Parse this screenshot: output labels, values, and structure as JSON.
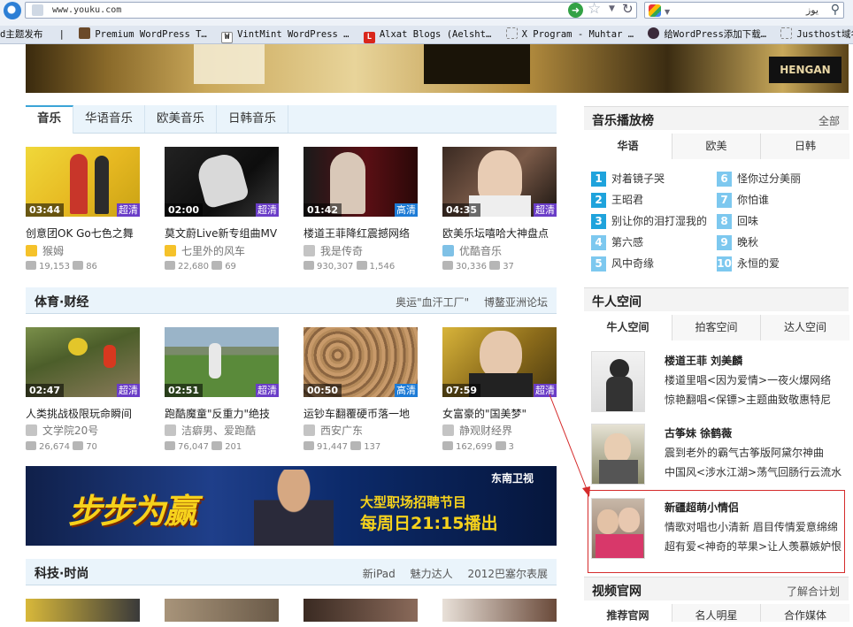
{
  "browser": {
    "url": "www.youku.com",
    "search_text": "يوز",
    "bookmarks": [
      "d主题发布",
      "Premium WordPress T…",
      "VintMint WordPress …",
      "Alxat Blogs (Aelsht…",
      "X Program - Muhtar …",
      "给WordPress添加下载…",
      "Justhost域名注册"
    ]
  },
  "music": {
    "tabs": [
      "音乐",
      "华语音乐",
      "欧美音乐",
      "日韩音乐"
    ],
    "videos": [
      {
        "duration": "03:44",
        "quality": "超清",
        "title": "创意团OK Go七色之舞",
        "user": "猴姆",
        "views": "19,153",
        "comments": "86"
      },
      {
        "duration": "02:00",
        "quality": "超清",
        "title": "莫文蔚Live新专组曲MV",
        "user": "七里外的风车",
        "views": "22,680",
        "comments": "69"
      },
      {
        "duration": "01:42",
        "quality": "高清",
        "title": "楼道王菲降红震撼网络",
        "user": "我是传奇",
        "views": "930,307",
        "comments": "1,546"
      },
      {
        "duration": "04:35",
        "quality": "超清",
        "title": "欧美乐坛嘻哈大神盘点",
        "user": "优酷音乐",
        "views": "30,336",
        "comments": "37"
      }
    ]
  },
  "sports": {
    "title": "体育·财经",
    "links": [
      "奥运\"血汗工厂\"",
      "博鳌亚洲论坛"
    ],
    "videos": [
      {
        "duration": "02:47",
        "quality": "超清",
        "title": "人类挑战极限玩命瞬间",
        "user": "文学院20号",
        "views": "26,674",
        "comments": "70"
      },
      {
        "duration": "02:51",
        "quality": "超清",
        "title": "跑酷魔童\"反重力\"绝技",
        "user": "洁癖男、爱跑酷",
        "views": "76,047",
        "comments": "201"
      },
      {
        "duration": "00:50",
        "quality": "高清",
        "title": "运钞车翻覆硬币落一地",
        "user": "西安广东",
        "views": "91,447",
        "comments": "137"
      },
      {
        "duration": "07:59",
        "quality": "超清",
        "title": "女富豪的\"国美梦\"",
        "user": "静观财经界",
        "views": "162,699",
        "comments": "3"
      }
    ]
  },
  "banner": {
    "channel": "东南卫视",
    "program": "大型职场招聘节目",
    "schedule": "每周日21:15播出"
  },
  "tech": {
    "title": "科技·时尚",
    "links": [
      "新iPad",
      "魅力达人",
      "2012巴塞尔表展"
    ]
  },
  "chart": {
    "title": "音乐播放榜",
    "more": "全部",
    "tabs": [
      "华语",
      "欧美",
      "日韩"
    ],
    "items": [
      "对着镜子哭",
      "王昭君",
      "别让你的泪打湿我的",
      "第六感",
      "风中奇缘",
      "怪你过分美丽",
      "你怕谁",
      "回味",
      "晚秋",
      "永恒的爱"
    ]
  },
  "people": {
    "title": "牛人空间",
    "tabs": [
      "牛人空间",
      "拍客空间",
      "达人空间"
    ],
    "stars": [
      {
        "name": "楼道王菲 刘美麟",
        "line1": "楼道里唱<因为爱情>一夜火爆网络",
        "line2": "惊艳翻唱<保镖>主题曲致敬惠特尼"
      },
      {
        "name": "古筝妹 徐鹤薇",
        "line1": "震到老外的霸气古筝版阿黛尔神曲",
        "line2": "中国风<涉水江湖>荡气回肠行云流水"
      },
      {
        "name": "新疆超萌小情侣",
        "line1": "情歌对唱也小清新 眉目传情爱意绵绵",
        "line2": "超有爱<神奇的苹果>让人羡慕嫉妒恨"
      }
    ]
  },
  "official": {
    "title": "视频官网",
    "more": "了解合计划",
    "tabs": [
      "推荐官网",
      "名人明星",
      "合作媒体"
    ]
  },
  "colors": {
    "accent": "#3ba4d7",
    "rank_top": "#1fa3dc",
    "rank_rest": "#7dc8ef",
    "super_hd": "#6a3dc7",
    "hd": "#1d7bd6",
    "highlight": "#d52b2b"
  }
}
